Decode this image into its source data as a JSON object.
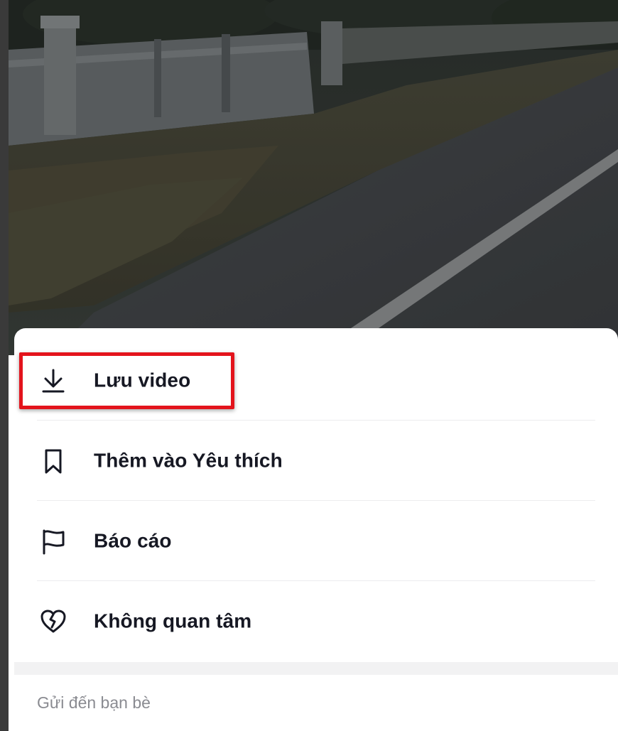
{
  "menu": {
    "items": [
      {
        "label": "Lưu video",
        "icon": "download-icon"
      },
      {
        "label": "Thêm vào Yêu thích",
        "icon": "bookmark-icon"
      },
      {
        "label": "Báo cáo",
        "icon": "flag-icon"
      },
      {
        "label": "Không quan tâm",
        "icon": "broken-heart-icon"
      }
    ]
  },
  "share": {
    "section_title": "Gửi đến bạn bè"
  },
  "colors": {
    "text": "#161823",
    "muted": "#8a8b91",
    "highlight": "#e3141c",
    "divider": "#ececee"
  }
}
